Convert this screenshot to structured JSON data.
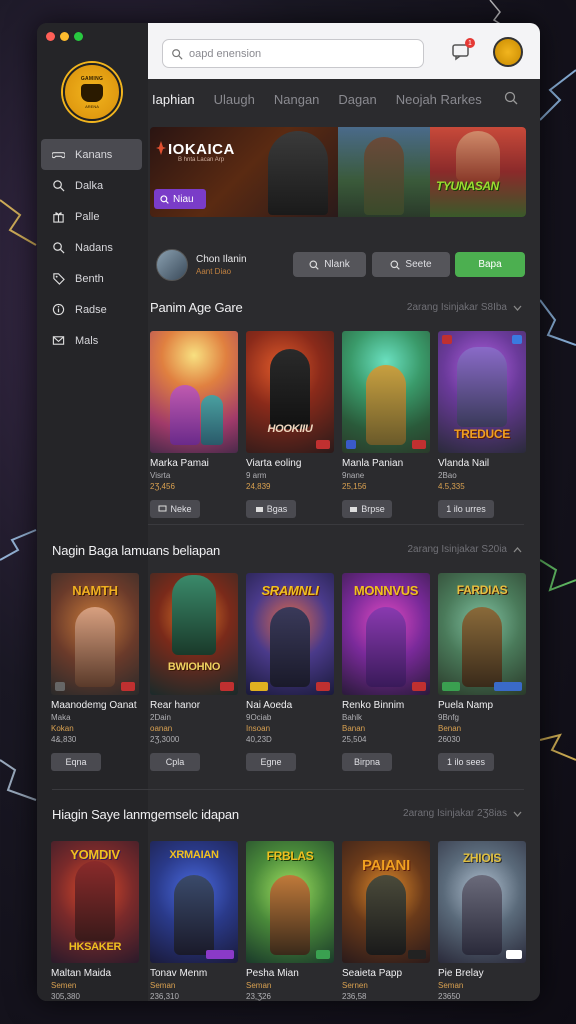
{
  "colors": {
    "accent_purple": "#7a3cc8",
    "accent_green": "#4caf50",
    "price": "#d8a050",
    "notif_red": "#e53935"
  },
  "window": {
    "traffic_lights": [
      "#ff5f57",
      "#febc2e",
      "#28c840"
    ]
  },
  "logo": {
    "top_text": "GAMING",
    "bottom_text": "ARENA"
  },
  "sidebar": {
    "items": [
      {
        "label": "Kanans",
        "icon": "controller-icon",
        "active": true
      },
      {
        "label": "Dalka",
        "icon": "search-icon"
      },
      {
        "label": "Palle",
        "icon": "gift-icon"
      },
      {
        "label": "Nadans",
        "icon": "search-icon"
      },
      {
        "label": "Benth",
        "icon": "tag-icon"
      },
      {
        "label": "Radse",
        "icon": "info-icon"
      },
      {
        "label": "Mals",
        "icon": "mail-icon"
      }
    ]
  },
  "search": {
    "placeholder": "oapd enension"
  },
  "notification": {
    "count": "1"
  },
  "tabs": [
    {
      "label": "Iaphian",
      "active": true
    },
    {
      "label": "Ulaugh"
    },
    {
      "label": "Nangan"
    },
    {
      "label": "Dagan"
    },
    {
      "label": "Neojah Rarkes"
    }
  ],
  "hero": {
    "title": "IOKAICA",
    "subtitle": "B hnta Lacan Arp",
    "button_label": "Niau",
    "card3_title": "TYUNASAN"
  },
  "user": {
    "name": "Chon Ilanin",
    "sub": "Aant Diao"
  },
  "actions": {
    "btn1": "Nlank",
    "btn2": "Seete",
    "btn3": "Bapa"
  },
  "sections": [
    {
      "title": "Panim Age Gare",
      "meta": "2arang Isinjakar  S8Iba",
      "cards": [
        {
          "name": "Marka Pamai",
          "line": "Visrta",
          "price": "2Ʒ,456",
          "button": "Neke",
          "img_title": "",
          "theme": "t1"
        },
        {
          "name": "Viarta eoling",
          "line": "9 arm",
          "price": "24,839",
          "button": "Bgas",
          "img_title": "HOOKIIU",
          "theme": "t2"
        },
        {
          "name": "Manla Panian",
          "line": "9nane",
          "price": "25,156",
          "button": "Brpse",
          "img_title": "",
          "theme": "t3"
        },
        {
          "name": "Vlanda Nail",
          "line": "2Bao",
          "price": "4.5,335",
          "button": "1 ilo urres",
          "img_title": "TREDUCE",
          "theme": "t4"
        }
      ]
    },
    {
      "title": "Nagin Baga lamuans beliapan",
      "meta": "2arang Isinjakar  S20ia",
      "cards": [
        {
          "name": "Maanodemg Oanat",
          "line": "Maka",
          "sub": "Kokan",
          "price": "4&,830",
          "button": "Eqna",
          "img_title": "NAMTH",
          "theme": "t5"
        },
        {
          "name": "Rear hanor",
          "line": "2Dain",
          "sub": "oanan",
          "price": "2Ʒ,3000",
          "button": "Cpla",
          "img_title": "BWIOHNO",
          "theme": "t6"
        },
        {
          "name": "Nai Aoeda",
          "line": "9Ociab",
          "sub": "Insoan",
          "price": "40,23D",
          "button": "Egne",
          "img_title": "SRAMNLI",
          "theme": "t7"
        },
        {
          "name": "Renko Binnim",
          "line": "Bahlk",
          "sub": "Banan",
          "price": "25,504",
          "button": "Birpna",
          "img_title": "MONNVUS",
          "theme": "t8"
        },
        {
          "name": "Puela Namp",
          "line": "9Bnfg",
          "sub": "Benan",
          "price": "26030",
          "button": "1 ilo sees",
          "img_title": "FARDIAS",
          "theme": "t9"
        }
      ]
    },
    {
      "title": "Hiagin Saye lanmgemselc idapan",
      "meta": "2arang Isinjakar  2Ʒ8ias",
      "cards": [
        {
          "name": "Maltan Maida",
          "line": "Semen",
          "price": "305,380",
          "img_title": "HKSAKER",
          "top_title": "YOMDIV",
          "theme": "t10"
        },
        {
          "name": "Tonav Menm",
          "line": "Seman",
          "price": "236,310",
          "img_title": "",
          "top_title": "XRMAIAN",
          "theme": "t11"
        },
        {
          "name": "Pesha Mian",
          "line": "Seman",
          "price": "23,Ʒ26",
          "img_title": "",
          "top_title": "FRBLAS",
          "theme": "t12"
        },
        {
          "name": "Seaieta Papp",
          "line": "Sernen",
          "price": "236,58",
          "img_title": "",
          "top_title": "PAIANI",
          "theme": "t13"
        },
        {
          "name": "Pie Brelay",
          "line": "Seman",
          "price": "23650",
          "img_title": "",
          "top_title": "ZHIOIS",
          "theme": "t14"
        }
      ]
    }
  ]
}
